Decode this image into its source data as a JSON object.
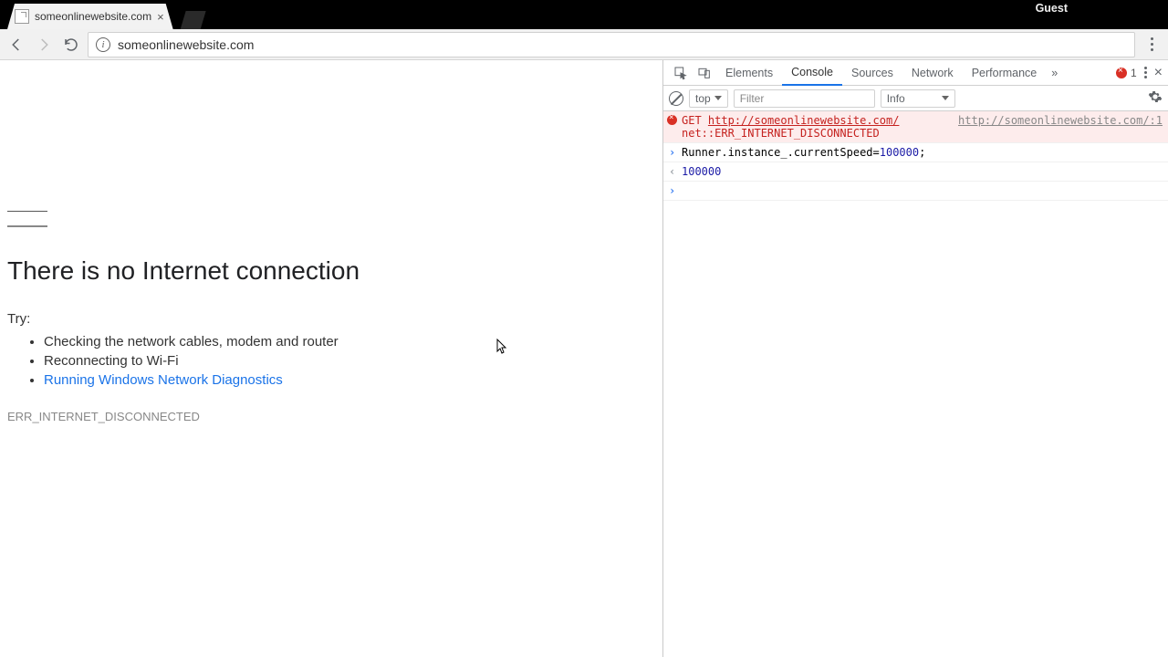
{
  "topbar": {
    "tab_title": "someonlinewebsite.com",
    "guest_label": "Guest"
  },
  "toolbar": {
    "url": "someonlinewebsite.com"
  },
  "page": {
    "title": "There is no Internet connection",
    "try_label": "Try:",
    "tips": [
      "Checking the network cables, modem and router",
      "Reconnecting to Wi-Fi",
      "Running Windows Network Diagnostics"
    ],
    "error_code": "ERR_INTERNET_DISCONNECTED"
  },
  "devtools": {
    "tabs": [
      "Elements",
      "Console",
      "Sources",
      "Network",
      "Performance"
    ],
    "active_tab": "Console",
    "overflow": "»",
    "error_count": "1",
    "console": {
      "context": "top",
      "filter_placeholder": "Filter",
      "level": "Info",
      "error": {
        "method": "GET",
        "url": "http://someonlinewebsite.com/",
        "message": "net::ERR_INTERNET_DISCONNECTED",
        "source": "http://someonlinewebsite.com/:1"
      },
      "input_line_pre": "Runner.instance_.currentSpeed=",
      "input_line_val": "100000",
      "input_line_post": ";",
      "output_line": "100000"
    }
  }
}
